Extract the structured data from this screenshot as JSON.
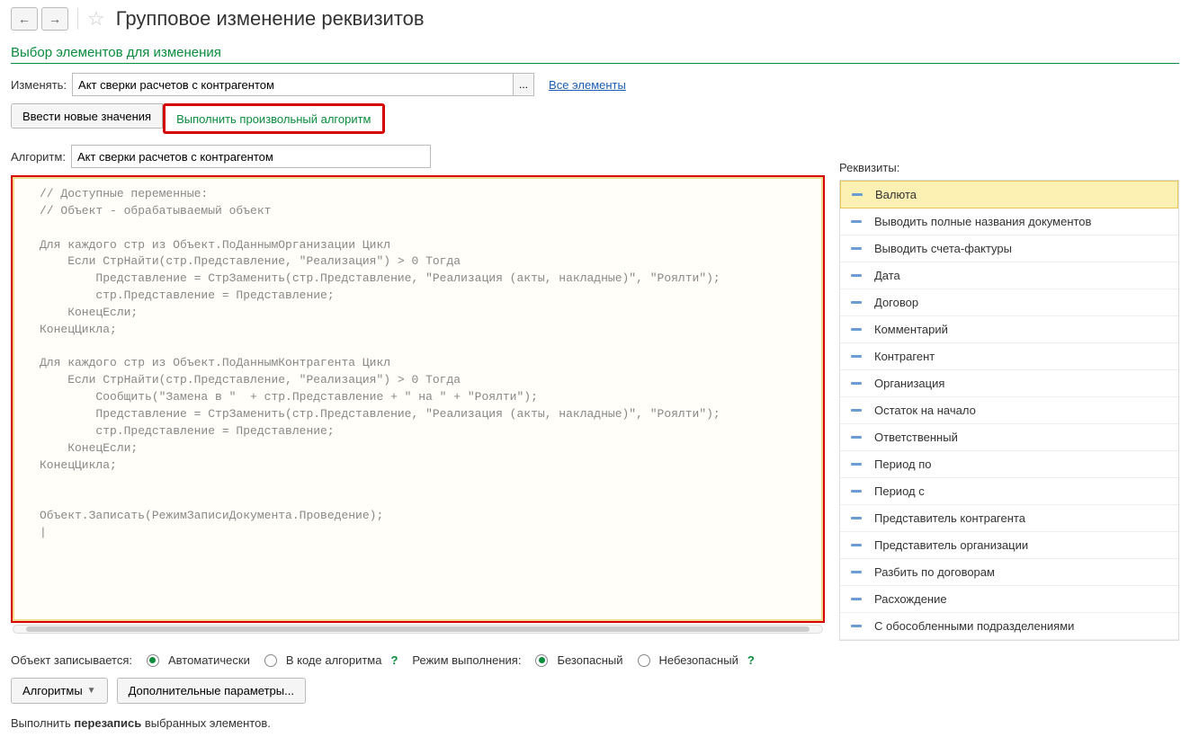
{
  "header": {
    "title": "Групповое изменение реквизитов"
  },
  "section": {
    "title": "Выбор элементов для изменения"
  },
  "change": {
    "label": "Изменять:",
    "value": "Акт сверки расчетов с контрагентом",
    "ellipsis": "...",
    "all_link": "Все элементы"
  },
  "tabs": {
    "enter_values": "Ввести новые значения",
    "run_algorithm": "Выполнить произвольный алгоритм"
  },
  "algorithm": {
    "label": "Алгоритм:",
    "value": "Акт сверки расчетов с контрагентом"
  },
  "code": "// Доступные переменные:\n// Объект - обрабатываемый объект\n\nДля каждого стр из Объект.ПоДаннымОрганизации Цикл\n    Если СтрНайти(стр.Представление, \"Реализация\") > 0 Тогда\n        Представление = СтрЗаменить(стр.Представление, \"Реализация (акты, накладные)\", \"Роялти\");\n        стр.Представление = Представление;\n    КонецЕсли;\nКонецЦикла;\n\nДля каждого стр из Объект.ПоДаннымКонтрагента Цикл\n    Если СтрНайти(стр.Представление, \"Реализация\") > 0 Тогда\n        Сообщить(\"Замена в \"  + стр.Представление + \" на \" + \"Роялти\");\n        Представление = СтрЗаменить(стр.Представление, \"Реализация (акты, накладные)\", \"Роялти\");\n        стр.Представление = Представление;\n    КонецЕсли;\nКонецЦикла;\n\n\nОбъект.Записать(РежимЗаписиДокумента.Проведение);\n|",
  "requisites": {
    "label": "Реквизиты:",
    "items": [
      "Валюта",
      "Выводить полные названия документов",
      "Выводить счета-фактуры",
      "Дата",
      "Договор",
      "Комментарий",
      "Контрагент",
      "Организация",
      "Остаток на начало",
      "Ответственный",
      "Период по",
      "Период с",
      "Представитель контрагента",
      "Представитель организации",
      "Разбить по договорам",
      "Расхождение",
      "С обособленными подразделениями"
    ],
    "selected_index": 0
  },
  "write_mode": {
    "label": "Объект записывается:",
    "auto": "Автоматически",
    "in_code": "В коде алгоритма",
    "help": "?"
  },
  "exec_mode": {
    "label": "Режим выполнения:",
    "safe": "Безопасный",
    "unsafe": "Небезопасный",
    "help": "?"
  },
  "buttons": {
    "algorithms": "Алгоритмы",
    "extra_params": "Дополнительные параметры..."
  },
  "summary": {
    "before": "Выполнить ",
    "bold": "перезапись",
    "after": " выбранных элементов."
  }
}
